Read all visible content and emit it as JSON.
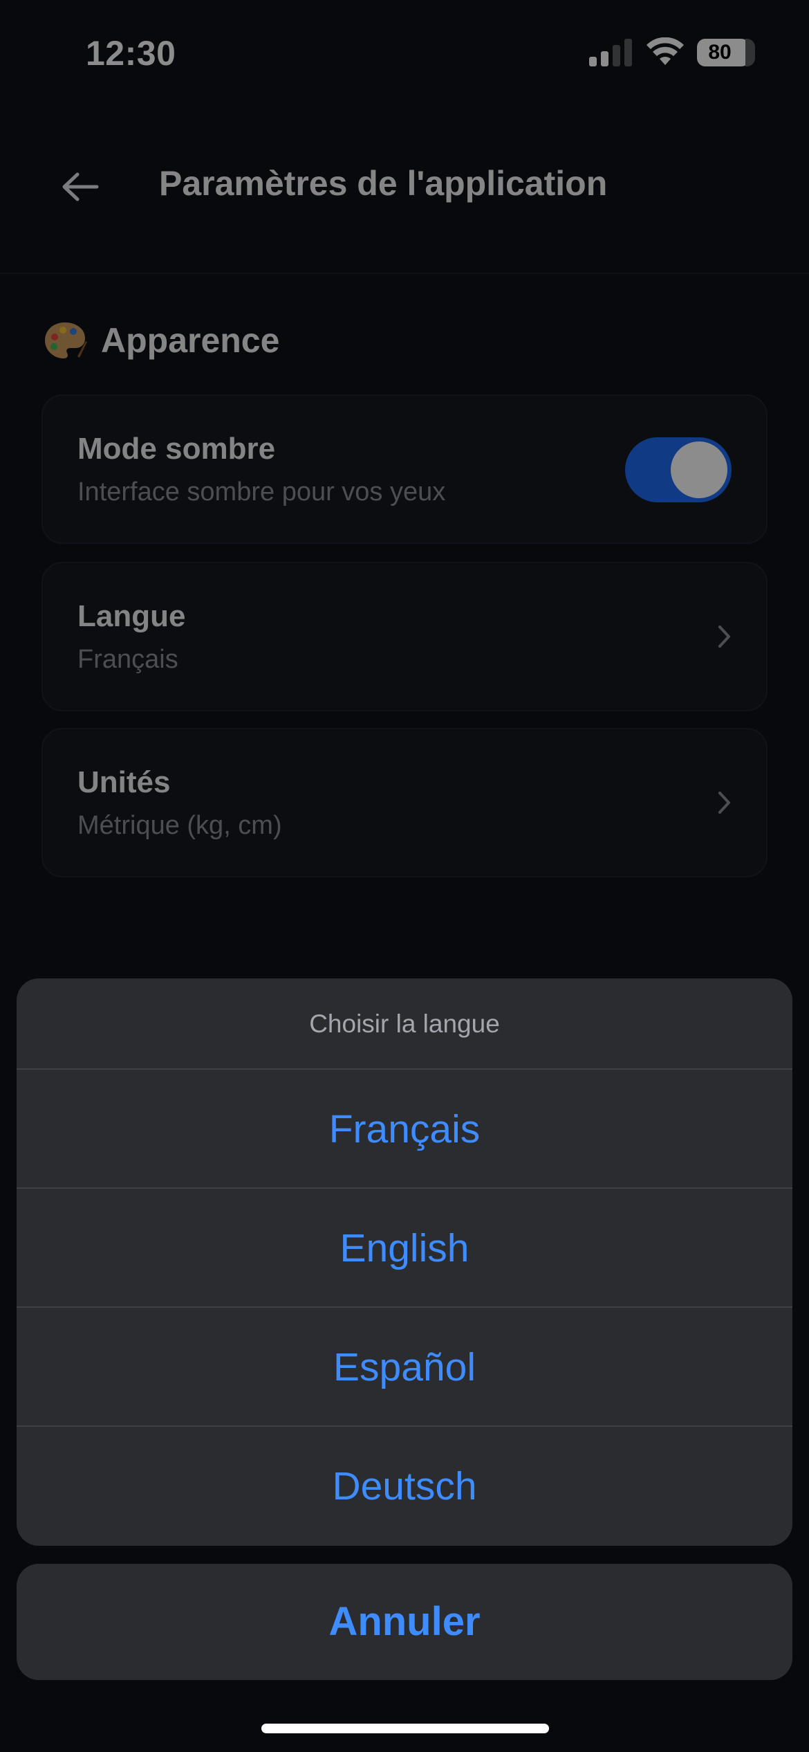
{
  "status_bar": {
    "time": "12:30",
    "battery": "80"
  },
  "header": {
    "title": "Paramètres de l'application",
    "back_icon": "arrow-left-icon"
  },
  "section": {
    "title": "Apparence",
    "icon": "palette-icon"
  },
  "settings": {
    "dark_mode": {
      "label": "Mode sombre",
      "subtitle": "Interface sombre pour vos yeux",
      "enabled": true
    },
    "language": {
      "label": "Langue",
      "value": "Français"
    },
    "units": {
      "label": "Unités",
      "value": "Métrique (kg, cm)"
    }
  },
  "language_sheet": {
    "title": "Choisir la langue",
    "options": [
      "Français",
      "English",
      "Español",
      "Deutsch"
    ],
    "cancel_label": "Annuler"
  },
  "colors": {
    "accent": "#3f8cff",
    "toggle_on": "#1f6bf0",
    "background": "#0e1116"
  }
}
